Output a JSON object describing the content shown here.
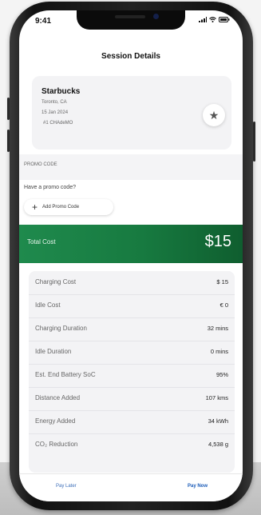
{
  "status_bar": {
    "time": "9:41"
  },
  "header": {
    "title": "Session Details"
  },
  "station": {
    "name": "Starbucks",
    "location": "Toronto, CA",
    "date": "15 Jan 2024",
    "connector": "#1 CHAdeMO",
    "favorite_icon": "star-icon"
  },
  "promo": {
    "section_label": "PROMO CODE",
    "question": "Have a promo code?",
    "add_label": "Add Promo Code"
  },
  "total": {
    "label": "Total Cost",
    "value": "$15",
    "color": "#1f8a4d"
  },
  "details": [
    {
      "label": "Charging Cost",
      "value": "$ 15"
    },
    {
      "label": "Idle Cost",
      "value": "€ 0"
    },
    {
      "label": "Charging Duration",
      "value": "32 mins"
    },
    {
      "label": "Idle Duration",
      "value": "0 mins"
    },
    {
      "label": "Est. End Battery SoC",
      "value": "95%"
    },
    {
      "label": "Distance Added",
      "value": "107 kms"
    },
    {
      "label": "Energy Added",
      "value": "34 kWh"
    },
    {
      "label": "CO₂ Reduction",
      "value": "4,538 g"
    }
  ],
  "actions": {
    "pay_later": "Pay Later",
    "pay_now": "Pay Now",
    "accent": "#1a5bb8"
  }
}
